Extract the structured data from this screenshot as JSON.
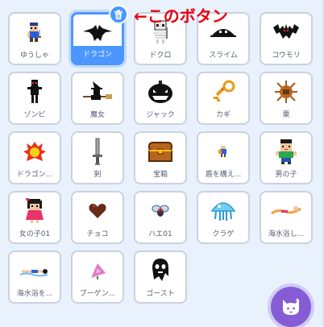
{
  "annotation": "←このボタン",
  "sprites": [
    {
      "label": "ゆうしゃ",
      "icon": "hero-icon"
    },
    {
      "label": "ドラゴン",
      "icon": "dragon-icon",
      "selected": true
    },
    {
      "label": "ドクロ",
      "icon": "skull-icon"
    },
    {
      "label": "スライム",
      "icon": "slime-icon"
    },
    {
      "label": "コウモリ",
      "icon": "bat-icon"
    },
    {
      "label": "ゾンビ",
      "icon": "zombie-icon"
    },
    {
      "label": "魔女",
      "icon": "witch-icon"
    },
    {
      "label": "ジャック",
      "icon": "jack-o-lantern-icon"
    },
    {
      "label": "カギ",
      "icon": "key-icon"
    },
    {
      "label": "栗",
      "icon": "chestnut-icon"
    },
    {
      "label": "ドラゴン...",
      "icon": "fire-icon"
    },
    {
      "label": "剣",
      "icon": "sword-icon"
    },
    {
      "label": "宝箱",
      "icon": "treasure-chest-icon"
    },
    {
      "label": "盾を構え...",
      "icon": "shield-hero-icon"
    },
    {
      "label": "男の子",
      "icon": "boy-icon"
    },
    {
      "label": "女の子01",
      "icon": "girl-icon"
    },
    {
      "label": "チョコ",
      "icon": "chocolate-heart-icon"
    },
    {
      "label": "ハエ01",
      "icon": "fly-icon"
    },
    {
      "label": "クラゲ",
      "icon": "jellyfish-icon"
    },
    {
      "label": "海水浴し...",
      "icon": "swimmer-icon"
    },
    {
      "label": "海水浴を...",
      "icon": "swimmer2-icon"
    },
    {
      "label": "ブーゲン...",
      "icon": "bougainvillea-icon"
    },
    {
      "label": "ゴースト",
      "icon": "ghost-icon"
    }
  ],
  "colors": {
    "accent": "#4c97ff",
    "annotation": "#e60012",
    "choose_button": "#855cd6"
  }
}
